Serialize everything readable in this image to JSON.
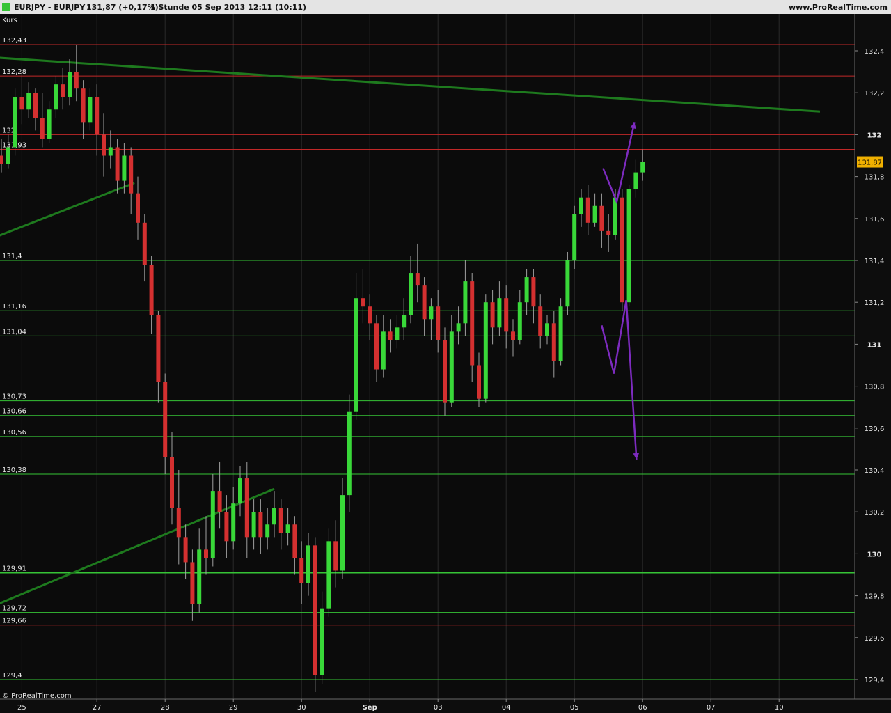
{
  "header": {
    "symbol": "EURJPY - EURJPY",
    "quote": "131,87 (+0,17%)",
    "period": "1 Stunde  05 Sep 2013 12:11 (10:11)",
    "site": "www.ProRealTime.com"
  },
  "footer": {
    "copyright": "© ProRealTime.com"
  },
  "colors": {
    "background": "#0b0b0b",
    "header": "#e4e4e4",
    "axis_panel": "#0d0d0d",
    "bull": "#39d839",
    "bear": "#d43030",
    "support": "#36c436",
    "resistance": "#c22828",
    "trendline": "#1e7a1e",
    "forecast": "#7d2bbf",
    "price_box": "#f0b000"
  },
  "chart_data": {
    "type": "candlestick",
    "title": "EURJPY - EURJPY",
    "panel_label": "Kurs",
    "last_price": 131.87,
    "last_price_label": "131,87",
    "ylim": [
      129.31,
      132.55
    ],
    "y_ticks": [
      {
        "v": 132.4,
        "label": "132,4",
        "bold": false
      },
      {
        "v": 132.2,
        "label": "132,2",
        "bold": false
      },
      {
        "v": 132.0,
        "label": "132",
        "bold": true
      },
      {
        "v": 131.8,
        "label": "131,8",
        "bold": false
      },
      {
        "v": 131.6,
        "label": "131,6",
        "bold": false
      },
      {
        "v": 131.4,
        "label": "131,4",
        "bold": false
      },
      {
        "v": 131.2,
        "label": "131,2",
        "bold": false
      },
      {
        "v": 131.0,
        "label": "131",
        "bold": true
      },
      {
        "v": 130.8,
        "label": "130,8",
        "bold": false
      },
      {
        "v": 130.6,
        "label": "130,6",
        "bold": false
      },
      {
        "v": 130.4,
        "label": "130,4",
        "bold": false
      },
      {
        "v": 130.2,
        "label": "130,2",
        "bold": false
      },
      {
        "v": 130.0,
        "label": "130",
        "bold": true
      },
      {
        "v": 129.8,
        "label": "129,8",
        "bold": false
      },
      {
        "v": 129.6,
        "label": "129,6",
        "bold": false
      },
      {
        "v": 129.4,
        "label": "129,4",
        "bold": false
      }
    ],
    "x_ticks": [
      {
        "t": 3,
        "label": "25",
        "bold": false
      },
      {
        "t": 14,
        "label": "27",
        "bold": false
      },
      {
        "t": 24,
        "label": "28",
        "bold": false
      },
      {
        "t": 34,
        "label": "29",
        "bold": false
      },
      {
        "t": 44,
        "label": "30",
        "bold": false
      },
      {
        "t": 54,
        "label": "Sep",
        "bold": true
      },
      {
        "t": 64,
        "label": "03",
        "bold": false
      },
      {
        "t": 74,
        "label": "04",
        "bold": false
      },
      {
        "t": 84,
        "label": "05",
        "bold": false
      },
      {
        "t": 94,
        "label": "06",
        "bold": false
      },
      {
        "t": 104,
        "label": "07",
        "bold": false
      },
      {
        "t": 114,
        "label": "10",
        "bold": false
      }
    ],
    "levels": [
      {
        "v": 132.43,
        "label": "132,43",
        "kind": "resistance"
      },
      {
        "v": 132.28,
        "label": "132,28",
        "kind": "resistance"
      },
      {
        "v": 132.0,
        "label": "132",
        "kind": "resistance"
      },
      {
        "v": 131.93,
        "label": "131,93",
        "kind": "resistance"
      },
      {
        "v": 131.4,
        "label": "131,4",
        "kind": "support"
      },
      {
        "v": 131.16,
        "label": "131,16",
        "kind": "support"
      },
      {
        "v": 131.04,
        "label": "131,04",
        "kind": "support"
      },
      {
        "v": 130.73,
        "label": "130,73",
        "kind": "support"
      },
      {
        "v": 130.66,
        "label": "130,66",
        "kind": "support"
      },
      {
        "v": 130.56,
        "label": "130,56",
        "kind": "support"
      },
      {
        "v": 130.38,
        "label": "130,38",
        "kind": "support"
      },
      {
        "v": 129.91,
        "label": "129,91",
        "kind": "support_major"
      },
      {
        "v": 129.72,
        "label": "129,72",
        "kind": "support"
      },
      {
        "v": 129.66,
        "label": "129,66",
        "kind": "resistance"
      },
      {
        "v": 129.4,
        "label": "129,4",
        "kind": "support"
      }
    ],
    "trendlines": [
      {
        "t1": -6.5,
        "v1": 132.38,
        "t2": 120,
        "v2": 132.11
      },
      {
        "t1": -6.5,
        "v1": 131.44,
        "t2": 19.5,
        "v2": 131.77
      },
      {
        "t1": -3.5,
        "v1": 129.72,
        "t2": 40,
        "v2": 130.31
      }
    ],
    "forecast_paths": [
      [
        [
          88.2,
          131.84
        ],
        [
          90.2,
          131.68
        ],
        [
          92.8,
          132.06
        ]
      ],
      [
        [
          88.0,
          131.09
        ],
        [
          89.8,
          130.86
        ],
        [
          91.6,
          131.21
        ],
        [
          93.1,
          130.45
        ]
      ]
    ],
    "candles": [
      {
        "o": 131.9,
        "h": 131.98,
        "c": 131.86,
        "l": 131.82
      },
      {
        "o": 131.86,
        "h": 132.0,
        "c": 131.94,
        "l": 131.84
      },
      {
        "o": 131.94,
        "h": 132.22,
        "c": 132.18,
        "l": 131.9
      },
      {
        "o": 132.18,
        "h": 132.3,
        "c": 132.12,
        "l": 132.05
      },
      {
        "o": 132.12,
        "h": 132.25,
        "c": 132.2,
        "l": 132.08
      },
      {
        "o": 132.2,
        "h": 132.22,
        "c": 132.08,
        "l": 132.02
      },
      {
        "o": 132.08,
        "h": 132.2,
        "c": 131.98,
        "l": 131.94
      },
      {
        "o": 131.98,
        "h": 132.16,
        "c": 132.12,
        "l": 131.96
      },
      {
        "o": 132.12,
        "h": 132.28,
        "c": 132.24,
        "l": 132.08
      },
      {
        "o": 132.24,
        "h": 132.32,
        "c": 132.18,
        "l": 132.12
      },
      {
        "o": 132.18,
        "h": 132.36,
        "c": 132.3,
        "l": 132.14
      },
      {
        "o": 132.3,
        "h": 132.43,
        "c": 132.22,
        "l": 132.16
      },
      {
        "o": 132.22,
        "h": 132.26,
        "c": 132.06,
        "l": 131.98
      },
      {
        "o": 132.06,
        "h": 132.22,
        "c": 132.18,
        "l": 132.02
      },
      {
        "o": 132.18,
        "h": 132.24,
        "c": 132.0,
        "l": 131.9
      },
      {
        "o": 132.0,
        "h": 132.1,
        "c": 131.9,
        "l": 131.8
      },
      {
        "o": 131.9,
        "h": 132.02,
        "c": 131.94,
        "l": 131.84
      },
      {
        "o": 131.94,
        "h": 131.98,
        "c": 131.78,
        "l": 131.72
      },
      {
        "o": 131.78,
        "h": 131.96,
        "c": 131.9,
        "l": 131.72
      },
      {
        "o": 131.9,
        "h": 131.94,
        "c": 131.72,
        "l": 131.62
      },
      {
        "o": 131.72,
        "h": 131.8,
        "c": 131.58,
        "l": 131.5
      },
      {
        "o": 131.58,
        "h": 131.62,
        "c": 131.38,
        "l": 131.3
      },
      {
        "o": 131.38,
        "h": 131.42,
        "c": 131.14,
        "l": 131.05
      },
      {
        "o": 131.14,
        "h": 131.16,
        "c": 130.82,
        "l": 130.72
      },
      {
        "o": 130.82,
        "h": 130.86,
        "c": 130.46,
        "l": 130.38
      },
      {
        "o": 130.46,
        "h": 130.58,
        "c": 130.22,
        "l": 130.14
      },
      {
        "o": 130.22,
        "h": 130.4,
        "c": 130.08,
        "l": 129.95
      },
      {
        "o": 130.08,
        "h": 130.14,
        "c": 129.96,
        "l": 129.88
      },
      {
        "o": 129.96,
        "h": 130.02,
        "c": 129.76,
        "l": 129.68
      },
      {
        "o": 129.76,
        "h": 130.12,
        "c": 130.02,
        "l": 129.72
      },
      {
        "o": 130.02,
        "h": 130.18,
        "c": 129.98,
        "l": 129.9
      },
      {
        "o": 129.98,
        "h": 130.38,
        "c": 130.3,
        "l": 129.94
      },
      {
        "o": 130.3,
        "h": 130.44,
        "c": 130.2,
        "l": 130.12
      },
      {
        "o": 130.2,
        "h": 130.28,
        "c": 130.06,
        "l": 129.98
      },
      {
        "o": 130.06,
        "h": 130.32,
        "c": 130.24,
        "l": 130.02
      },
      {
        "o": 130.24,
        "h": 130.42,
        "c": 130.36,
        "l": 130.18
      },
      {
        "o": 130.36,
        "h": 130.44,
        "c": 130.08,
        "l": 129.98
      },
      {
        "o": 130.08,
        "h": 130.26,
        "c": 130.2,
        "l": 130.02
      },
      {
        "o": 130.2,
        "h": 130.26,
        "c": 130.08,
        "l": 130.0
      },
      {
        "o": 130.08,
        "h": 130.22,
        "c": 130.14,
        "l": 130.02
      },
      {
        "o": 130.14,
        "h": 130.3,
        "c": 130.22,
        "l": 130.08
      },
      {
        "o": 130.22,
        "h": 130.26,
        "c": 130.1,
        "l": 130.02
      },
      {
        "o": 130.1,
        "h": 130.22,
        "c": 130.14,
        "l": 130.04
      },
      {
        "o": 130.14,
        "h": 130.18,
        "c": 129.98,
        "l": 129.9
      },
      {
        "o": 129.98,
        "h": 130.06,
        "c": 129.86,
        "l": 129.76
      },
      {
        "o": 129.86,
        "h": 130.1,
        "c": 130.04,
        "l": 129.8
      },
      {
        "o": 130.04,
        "h": 130.08,
        "c": 129.42,
        "l": 129.34
      },
      {
        "o": 129.42,
        "h": 129.82,
        "c": 129.74,
        "l": 129.38
      },
      {
        "o": 129.74,
        "h": 130.12,
        "c": 130.06,
        "l": 129.7
      },
      {
        "o": 130.06,
        "h": 130.16,
        "c": 129.92,
        "l": 129.84
      },
      {
        "o": 129.92,
        "h": 130.36,
        "c": 130.28,
        "l": 129.88
      },
      {
        "o": 130.28,
        "h": 130.76,
        "c": 130.68,
        "l": 130.2
      },
      {
        "o": 130.68,
        "h": 131.34,
        "c": 131.22,
        "l": 130.64
      },
      {
        "o": 131.22,
        "h": 131.36,
        "c": 131.18,
        "l": 131.1
      },
      {
        "o": 131.18,
        "h": 131.24,
        "c": 131.1,
        "l": 131.02
      },
      {
        "o": 131.1,
        "h": 131.14,
        "c": 130.88,
        "l": 130.82
      },
      {
        "o": 130.88,
        "h": 131.14,
        "c": 131.06,
        "l": 130.84
      },
      {
        "o": 131.06,
        "h": 131.12,
        "c": 131.02,
        "l": 130.96
      },
      {
        "o": 131.02,
        "h": 131.14,
        "c": 131.08,
        "l": 130.98
      },
      {
        "o": 131.08,
        "h": 131.22,
        "c": 131.14,
        "l": 131.02
      },
      {
        "o": 131.14,
        "h": 131.42,
        "c": 131.34,
        "l": 131.1
      },
      {
        "o": 131.34,
        "h": 131.48,
        "c": 131.28,
        "l": 131.2
      },
      {
        "o": 131.28,
        "h": 131.32,
        "c": 131.12,
        "l": 131.04
      },
      {
        "o": 131.12,
        "h": 131.22,
        "c": 131.18,
        "l": 131.02
      },
      {
        "o": 131.18,
        "h": 131.26,
        "c": 131.02,
        "l": 130.96
      },
      {
        "o": 131.02,
        "h": 131.08,
        "c": 130.72,
        "l": 130.66
      },
      {
        "o": 130.72,
        "h": 131.14,
        "c": 131.06,
        "l": 130.7
      },
      {
        "o": 131.06,
        "h": 131.18,
        "c": 131.1,
        "l": 131.0
      },
      {
        "o": 131.1,
        "h": 131.4,
        "c": 131.3,
        "l": 131.04
      },
      {
        "o": 131.3,
        "h": 131.34,
        "c": 130.9,
        "l": 130.82
      },
      {
        "o": 130.9,
        "h": 130.96,
        "c": 130.74,
        "l": 130.7
      },
      {
        "o": 130.74,
        "h": 131.24,
        "c": 131.2,
        "l": 130.72
      },
      {
        "o": 131.2,
        "h": 131.26,
        "c": 131.08,
        "l": 131.0
      },
      {
        "o": 131.08,
        "h": 131.3,
        "c": 131.22,
        "l": 131.04
      },
      {
        "o": 131.22,
        "h": 131.28,
        "c": 131.06,
        "l": 130.98
      },
      {
        "o": 131.06,
        "h": 131.12,
        "c": 131.02,
        "l": 130.94
      },
      {
        "o": 131.02,
        "h": 131.26,
        "c": 131.2,
        "l": 131.0
      },
      {
        "o": 131.2,
        "h": 131.36,
        "c": 131.32,
        "l": 131.14
      },
      {
        "o": 131.32,
        "h": 131.36,
        "c": 131.18,
        "l": 131.1
      },
      {
        "o": 131.18,
        "h": 131.24,
        "c": 131.04,
        "l": 130.98
      },
      {
        "o": 131.04,
        "h": 131.14,
        "c": 131.1,
        "l": 131.0
      },
      {
        "o": 131.1,
        "h": 131.16,
        "c": 130.92,
        "l": 130.84
      },
      {
        "o": 130.92,
        "h": 131.22,
        "c": 131.18,
        "l": 130.9
      },
      {
        "o": 131.18,
        "h": 131.44,
        "c": 131.4,
        "l": 131.14
      },
      {
        "o": 131.4,
        "h": 131.66,
        "c": 131.62,
        "l": 131.36
      },
      {
        "o": 131.62,
        "h": 131.74,
        "c": 131.7,
        "l": 131.56
      },
      {
        "o": 131.7,
        "h": 131.76,
        "c": 131.58,
        "l": 131.52
      },
      {
        "o": 131.58,
        "h": 131.72,
        "c": 131.66,
        "l": 131.56
      },
      {
        "o": 131.66,
        "h": 131.72,
        "c": 131.54,
        "l": 131.46
      },
      {
        "o": 131.54,
        "h": 131.62,
        "c": 131.52,
        "l": 131.44
      },
      {
        "o": 131.52,
        "h": 131.74,
        "c": 131.7,
        "l": 131.5
      },
      {
        "o": 131.7,
        "h": 131.74,
        "c": 131.2,
        "l": 131.16
      },
      {
        "o": 131.2,
        "h": 131.76,
        "c": 131.74,
        "l": 131.18
      },
      {
        "o": 131.74,
        "h": 131.88,
        "c": 131.82,
        "l": 131.7
      },
      {
        "o": 131.82,
        "h": 131.93,
        "c": 131.87,
        "l": 131.78
      }
    ]
  }
}
